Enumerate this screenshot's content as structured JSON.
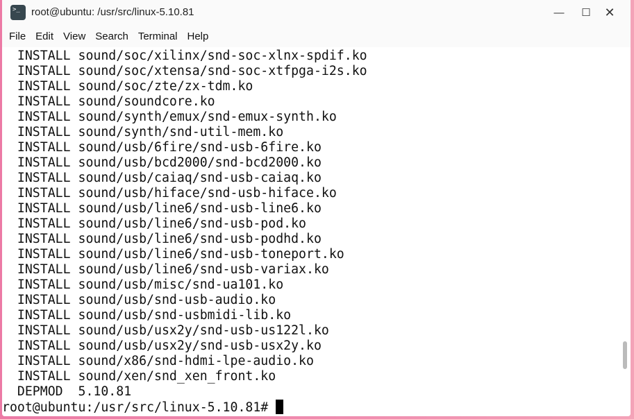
{
  "window": {
    "title": "root@ubuntu: /usr/src/linux-5.10.81"
  },
  "menu": [
    "File",
    "Edit",
    "View",
    "Search",
    "Terminal",
    "Help"
  ],
  "terminal": {
    "lines": [
      "  INSTALL sound/soc/xilinx/snd-soc-xlnx-spdif.ko",
      "  INSTALL sound/soc/xtensa/snd-soc-xtfpga-i2s.ko",
      "  INSTALL sound/soc/zte/zx-tdm.ko",
      "  INSTALL sound/soundcore.ko",
      "  INSTALL sound/synth/emux/snd-emux-synth.ko",
      "  INSTALL sound/synth/snd-util-mem.ko",
      "  INSTALL sound/usb/6fire/snd-usb-6fire.ko",
      "  INSTALL sound/usb/bcd2000/snd-bcd2000.ko",
      "  INSTALL sound/usb/caiaq/snd-usb-caiaq.ko",
      "  INSTALL sound/usb/hiface/snd-usb-hiface.ko",
      "  INSTALL sound/usb/line6/snd-usb-line6.ko",
      "  INSTALL sound/usb/line6/snd-usb-pod.ko",
      "  INSTALL sound/usb/line6/snd-usb-podhd.ko",
      "  INSTALL sound/usb/line6/snd-usb-toneport.ko",
      "  INSTALL sound/usb/line6/snd-usb-variax.ko",
      "  INSTALL sound/usb/misc/snd-ua101.ko",
      "  INSTALL sound/usb/snd-usb-audio.ko",
      "  INSTALL sound/usb/snd-usbmidi-lib.ko",
      "  INSTALL sound/usb/usx2y/snd-usb-us122l.ko",
      "  INSTALL sound/usb/usx2y/snd-usb-usx2y.ko",
      "  INSTALL sound/x86/snd-hdmi-lpe-audio.ko",
      "  INSTALL sound/xen/snd_xen_front.ko",
      "  DEPMOD  5.10.81"
    ],
    "prompt": "root@ubuntu:/usr/src/linux-5.10.81#"
  }
}
